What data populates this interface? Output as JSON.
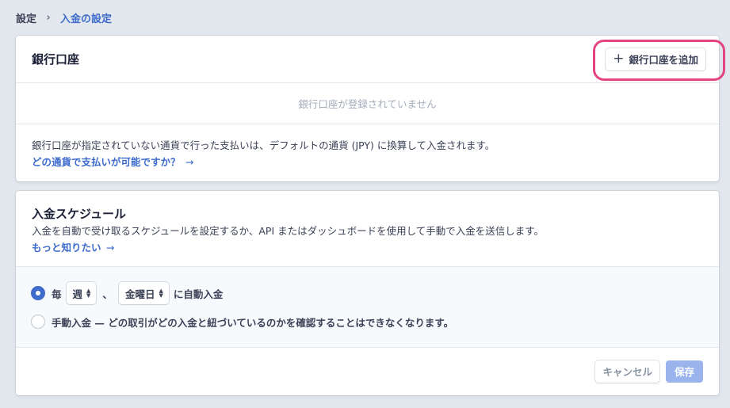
{
  "breadcrumb": {
    "parent": "設定",
    "separator": "›",
    "current": "入金の設定"
  },
  "bank": {
    "title": "銀行口座",
    "add_button_label": "銀行口座を追加",
    "add_icon": "plus-icon",
    "empty_text": "銀行口座が登録されていません",
    "info_text": "銀行口座が指定されていない通貨で行った支払いは、デフォルトの通貨 (JPY) に換算して入金されます。",
    "info_link": "どの通貨で支払いが可能ですか？",
    "link_arrow": "→"
  },
  "schedule": {
    "title": "入金スケジュール",
    "description": "入金を自動で受け取るスケジュールを設定するか、API またはダッシュボードを使用して手動で入金を送信します。",
    "learn_more_link": "もっと知りたい",
    "auto_option": {
      "prefix": "毎",
      "interval_value": "週",
      "separator": "、",
      "day_value": "金曜日",
      "suffix": "に自動入金",
      "selected": true
    },
    "manual_option": {
      "label": "手動入金 — どの取引がどの入金と紐づいているのかを確認することはできなくなります。",
      "selected": false
    },
    "cancel_label": "キャンセル",
    "save_label": "保存"
  },
  "colors": {
    "accent": "#3d6bcc",
    "highlight": "#e2457f",
    "save_disabled": "#9cb4ed",
    "page_bg": "#e3e8ee"
  }
}
